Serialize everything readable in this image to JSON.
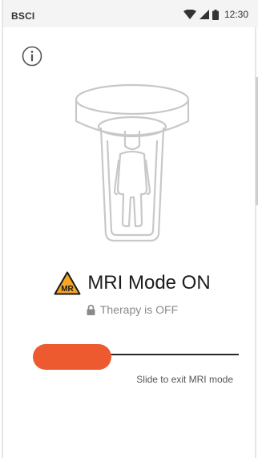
{
  "status_bar": {
    "carrier": "BSCI",
    "time": "12:30",
    "icons": [
      "wifi-icon",
      "signal-icon",
      "battery-icon"
    ]
  },
  "header": {
    "info_icon": "info-icon"
  },
  "illustration": {
    "icon": "mri-scanner-person-icon"
  },
  "mode": {
    "badge_text": "MR",
    "badge_color": "#f5a623",
    "title": "MRI Mode ON"
  },
  "therapy": {
    "icon": "lock-icon",
    "text": "Therapy is OFF"
  },
  "slider": {
    "color": "#ee5a2f",
    "caption": "Slide to exit MRI mode",
    "position": 0
  }
}
